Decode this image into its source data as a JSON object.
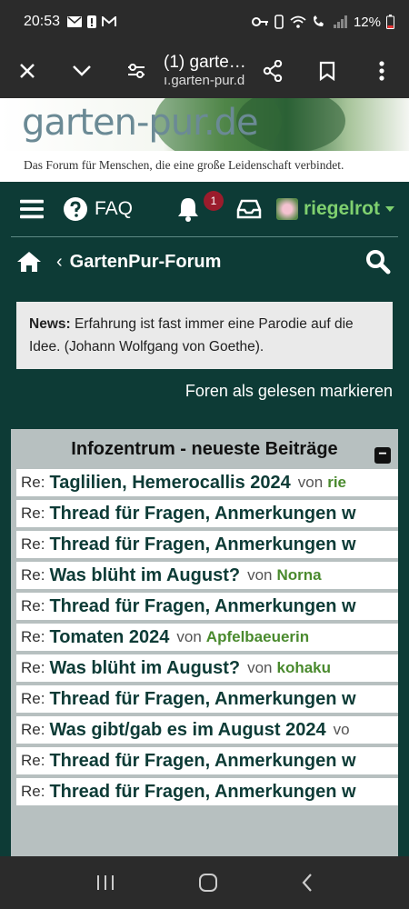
{
  "status_bar": {
    "time": "20:53",
    "battery": "12%"
  },
  "browser": {
    "tab_title": "(1) garte…",
    "url": "ı.garten-pur.de"
  },
  "banner": {
    "logo": "garten-pur.de",
    "tagline": "Das Forum für Menschen, die eine große Leidenschaft verbindet."
  },
  "nav": {
    "faq": "FAQ",
    "notification_count": "1",
    "username": "riegelrot"
  },
  "breadcrumb": {
    "separator": "‹",
    "forum": "GartenPur-Forum"
  },
  "news": {
    "label": "News:",
    "text": "Erfahrung ist fast immer eine Parodie auf die Idee. (Johann Wolfgang von Goethe)."
  },
  "mark_read": "Foren als gelesen markieren",
  "panel": {
    "title": "Infozentrum - neueste Beiträge",
    "collapse": "−",
    "rows": [
      {
        "prefix": "Re:",
        "topic": "Taglilien, Hemerocallis 2024",
        "von": "von",
        "author": "rie"
      },
      {
        "prefix": "Re:",
        "topic": "Thread für Fragen, Anmerkungen w",
        "von": "",
        "author": ""
      },
      {
        "prefix": "Re:",
        "topic": "Thread für Fragen, Anmerkungen w",
        "von": "",
        "author": ""
      },
      {
        "prefix": "Re:",
        "topic": "Was blüht im August?",
        "von": "von",
        "author": "Norna"
      },
      {
        "prefix": "Re:",
        "topic": "Thread für Fragen, Anmerkungen w",
        "von": "",
        "author": ""
      },
      {
        "prefix": "Re:",
        "topic": "Tomaten 2024",
        "von": "von",
        "author": "Apfelbaeuerin"
      },
      {
        "prefix": "Re:",
        "topic": "Was blüht im August?",
        "von": "von",
        "author": "kohaku"
      },
      {
        "prefix": "Re:",
        "topic": "Thread für Fragen, Anmerkungen w",
        "von": "",
        "author": ""
      },
      {
        "prefix": "Re:",
        "topic": "Was gibt/gab es im August 2024",
        "von": "vo",
        "author": ""
      },
      {
        "prefix": "Re:",
        "topic": "Thread für Fragen, Anmerkungen w",
        "von": "",
        "author": ""
      },
      {
        "prefix": "Re:",
        "topic": "Thread für Fragen, Anmerkungen w",
        "von": "",
        "author": ""
      }
    ]
  },
  "colors": {
    "forum_bg": "#0d3b36",
    "author_green": "#4a8a2e",
    "badge_red": "#9b1c2c",
    "username_green": "#7fd06f"
  }
}
